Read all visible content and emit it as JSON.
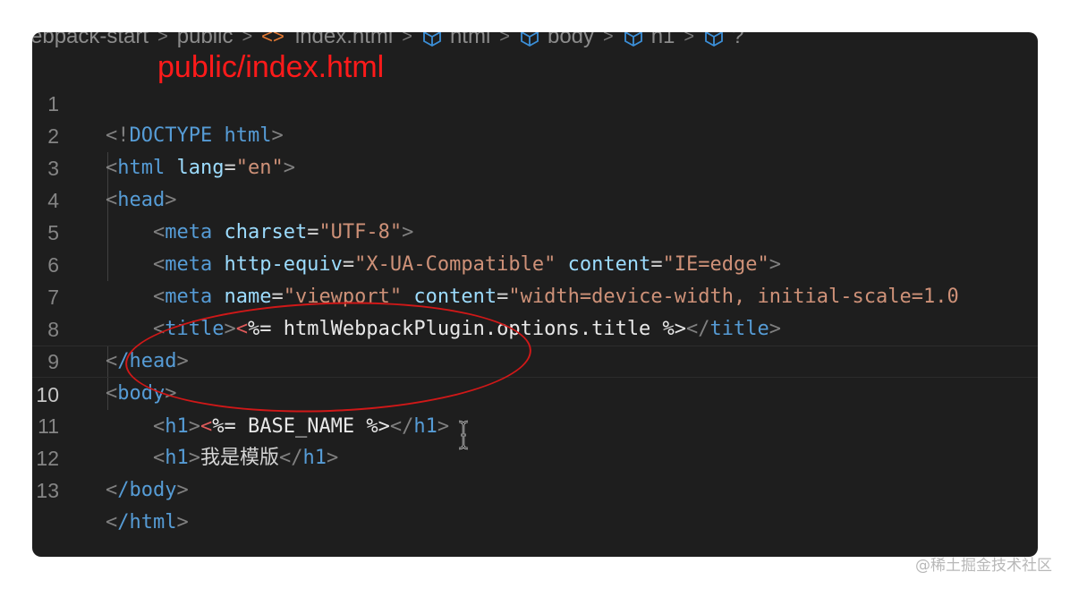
{
  "breadcrumb": {
    "items": [
      "ebpack-start",
      "public",
      "index.html",
      "html",
      "body",
      "h1",
      "?"
    ],
    "separator": ">"
  },
  "annotation": {
    "title": "public/index.html",
    "color": "#ff1a1a",
    "highlight_color": "#d01818"
  },
  "editor": {
    "current_line": 10,
    "lines": [
      {
        "n": "1",
        "c": "DOCTYPE html"
      },
      {
        "n": "2",
        "tag": "html",
        "attr": "lang",
        "val": "\"en\""
      },
      {
        "n": "3",
        "tag": "head"
      },
      {
        "n": "4",
        "tag": "meta",
        "attr": "charset",
        "val": "\"UTF-8\""
      },
      {
        "n": "5",
        "tag": "meta",
        "attr": "http-equiv",
        "val": "\"X-UA-Compatible\"",
        "attr2": "content",
        "val2": "\"IE=edge\""
      },
      {
        "n": "6",
        "tag": "meta",
        "attr": "name",
        "val": "\"viewport\"",
        "attr2": "content",
        "val2": "\"width=device-width, initial-scale=1.0"
      },
      {
        "n": "7",
        "tag": "title",
        "ejs": "%= htmlWebpackPlugin.options.title %"
      },
      {
        "n": "8",
        "tag": "/head"
      },
      {
        "n": "9",
        "tag": "body"
      },
      {
        "n": "10",
        "tag": "h1",
        "ejs": "%= BASE_NAME %"
      },
      {
        "n": "11",
        "tag": "h1",
        "text": "我是模版"
      },
      {
        "n": "12",
        "tag": "/body"
      },
      {
        "n": "13",
        "tag": "/html"
      }
    ]
  },
  "watermark": "@稀土掘金技术社区",
  "colors": {
    "editor_bg": "#1e1e1e",
    "tag": "#569cd6",
    "attribute": "#9cdcfe",
    "string": "#ce9178",
    "bracket": "#808080"
  }
}
